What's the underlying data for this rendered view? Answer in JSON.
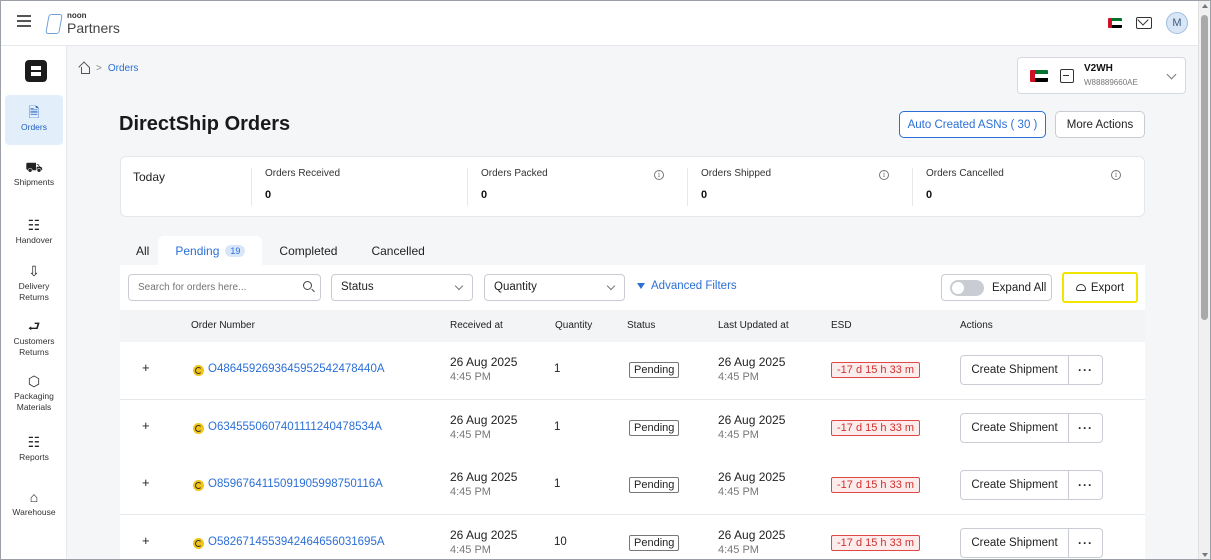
{
  "header": {
    "logo_small": "noon",
    "logo_big": "Partners",
    "avatar_initial": "M"
  },
  "sidebar": {
    "items": [
      {
        "label": "Orders",
        "icon": "receipt-icon"
      },
      {
        "label": "Shipments",
        "icon": "truck-icon"
      },
      {
        "label": "Handover",
        "icon": "handover-icon"
      },
      {
        "label": "Delivery Returns",
        "icon": "delivery-returns-icon"
      },
      {
        "label": "Customers Returns",
        "icon": "customer-returns-icon"
      },
      {
        "label": "Packaging Materials",
        "icon": "package-icon"
      },
      {
        "label": "Reports",
        "icon": "clipboard-icon"
      },
      {
        "label": "Warehouse",
        "icon": "warehouse-icon"
      }
    ]
  },
  "breadcrumb": {
    "current": "Orders"
  },
  "warehouse": {
    "name": "V2WH",
    "code": "W88889660AE"
  },
  "page": {
    "title": "DirectShip Orders",
    "asn_button": "Auto Created ASNs ( 30 )",
    "more_actions": "More Actions"
  },
  "stats": {
    "period": "Today",
    "items": [
      {
        "label": "Orders Received",
        "value": "0"
      },
      {
        "label": "Orders Packed",
        "value": "0"
      },
      {
        "label": "Orders Shipped",
        "value": "0"
      },
      {
        "label": "Orders Cancelled",
        "value": "0"
      }
    ]
  },
  "tabs": [
    {
      "label": "All"
    },
    {
      "label": "Pending",
      "badge": "19"
    },
    {
      "label": "Completed"
    },
    {
      "label": "Cancelled"
    }
  ],
  "filters": {
    "search_placeholder": "Search for orders here...",
    "status": "Status",
    "quantity": "Quantity",
    "advanced": "Advanced Filters",
    "expand_all": "Expand All",
    "export": "Export"
  },
  "table": {
    "columns": [
      "Order Number",
      "Received at",
      "Quantity",
      "Status",
      "Last Updated at",
      "ESD",
      "Actions"
    ],
    "rows": [
      {
        "order": "O48645926936459525424784​40A",
        "recv_date": "26 Aug 2025",
        "recv_time": "4:45 PM",
        "qty": "1",
        "status": "Pending",
        "upd_date": "26 Aug 2025",
        "upd_time": "4:45 PM",
        "esd": "-17 d 15 h 33 m"
      },
      {
        "order": "O634555060740111124047853​4A",
        "recv_date": "26 Aug 2025",
        "recv_time": "4:45 PM",
        "qty": "1",
        "status": "Pending",
        "upd_date": "26 Aug 2025",
        "upd_time": "4:45 PM",
        "esd": "-17 d 15 h 33 m"
      },
      {
        "order": "O85967641150919059987501​16A",
        "recv_date": "26 Aug 2025",
        "recv_time": "4:45 PM",
        "qty": "1",
        "status": "Pending",
        "upd_date": "26 Aug 2025",
        "upd_time": "4:45 PM",
        "esd": "-17 d 15 h 33 m"
      },
      {
        "order": "O58267145539424646560316​95A",
        "recv_date": "26 Aug 2025",
        "recv_time": "4:45 PM",
        "qty": "10",
        "status": "Pending",
        "upd_date": "26 Aug 2025",
        "upd_time": "4:45 PM",
        "esd": "-17 d 15 h 33 m"
      }
    ],
    "create_label": "Create Shipment",
    "more_label": "···"
  }
}
